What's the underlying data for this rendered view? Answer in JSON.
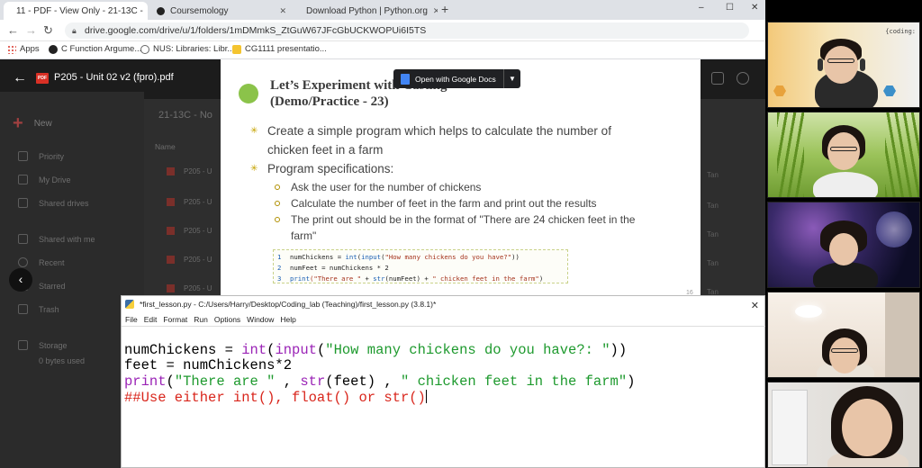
{
  "browser": {
    "tabs": [
      {
        "label": "11 - PDF - View Only - 21-13C - ",
        "active": true
      },
      {
        "label": "Coursemology",
        "active": false
      },
      {
        "label": "Download Python | Python.org",
        "active": false
      }
    ],
    "url": "drive.google.com/drive/u/1/folders/1mDMmkS_ZtGuW67JFcGbUCKWOPUi6I5TS",
    "bookmarks": [
      "Apps",
      "C Function Argume...",
      "NUS: Libraries: Libr...",
      "CG1111 presentatio..."
    ]
  },
  "drive": {
    "file_title": "P205 - Unit 02 v2 (fpro).pdf",
    "folder_title": "21-13C - No",
    "new_label": "New",
    "name_header": "Name",
    "nav_items": [
      "Priority",
      "My Drive",
      "Shared drives",
      "Shared with me",
      "Recent",
      "Starred",
      "Trash",
      "Storage",
      "0 bytes used"
    ],
    "file_rows": [
      "P205 - U",
      "P205 - U",
      "P205 - U",
      "P205 - U",
      "P205 - U"
    ],
    "owner_col": [
      "Tan",
      "Tan",
      "Tan",
      "Tan",
      "Tan"
    ],
    "open_with_label": "Open with Google Docs"
  },
  "slide": {
    "title_line1": "Let’s Experiment with Casting",
    "title_line2": "(Demo/Practice - 23)",
    "bullet1_line1": "Create a simple program which helps to calculate the number of",
    "bullet1_line2": "chicken feet in a farm",
    "bullet2": "Program specifications:",
    "sub1": "Ask the user for the number of chickens",
    "sub2": "Calculate the number of feet in the farm and print out the results",
    "sub3_line1": "The print out should be in the format of \"There are 24 chicken feet in the",
    "sub3_line2": "farm\"",
    "code": [
      {
        "n": "1",
        "a": "numChickens = ",
        "b": "int",
        "c": "(",
        "d": "input",
        "e": "(",
        "s": "\"How many chickens do you have?\"",
        "f": "))"
      },
      {
        "n": "2",
        "a": "numFeet = numChickens * 2"
      },
      {
        "n": "3",
        "k": "print",
        "s1": "(\"There are \"",
        "m": " + ",
        "k2": "str",
        "m2": "(numFeet) + ",
        "s2": "\" chicken feet in the farm\"",
        "e": ")"
      }
    ],
    "page_number": "16"
  },
  "idle": {
    "title": "*first_lesson.py - C:/Users/Harry/Desktop/Coding_lab (Teaching)/first_lesson.py (3.8.1)*",
    "menu": [
      "File",
      "Edit",
      "Format",
      "Run",
      "Options",
      "Window",
      "Help"
    ],
    "line1_a": "numChickens = ",
    "line1_int": "int",
    "line1_b": "(",
    "line1_input": "input",
    "line1_c": "(",
    "line1_str": "\"How many chickens do you have?: \"",
    "line1_d": "))",
    "line2": "feet = numChickens*2",
    "line3_print": "print",
    "line3_a": "(",
    "line3_s1": "\"There are \"",
    "line3_b": " , ",
    "line3_str": "str",
    "line3_c": "(feet) , ",
    "line3_s2": "\" chicken feet in the farm\"",
    "line3_d": ")",
    "line4_comment": "##Use either int(), float() or str()"
  },
  "video": {
    "tile1_tag": "{coding:"
  },
  "colors": {
    "idle_keyword": "#9a23b6",
    "idle_string": "#1e9a2e",
    "idle_comment": "#d9261c",
    "slide_bullet": "#8bc34a"
  }
}
